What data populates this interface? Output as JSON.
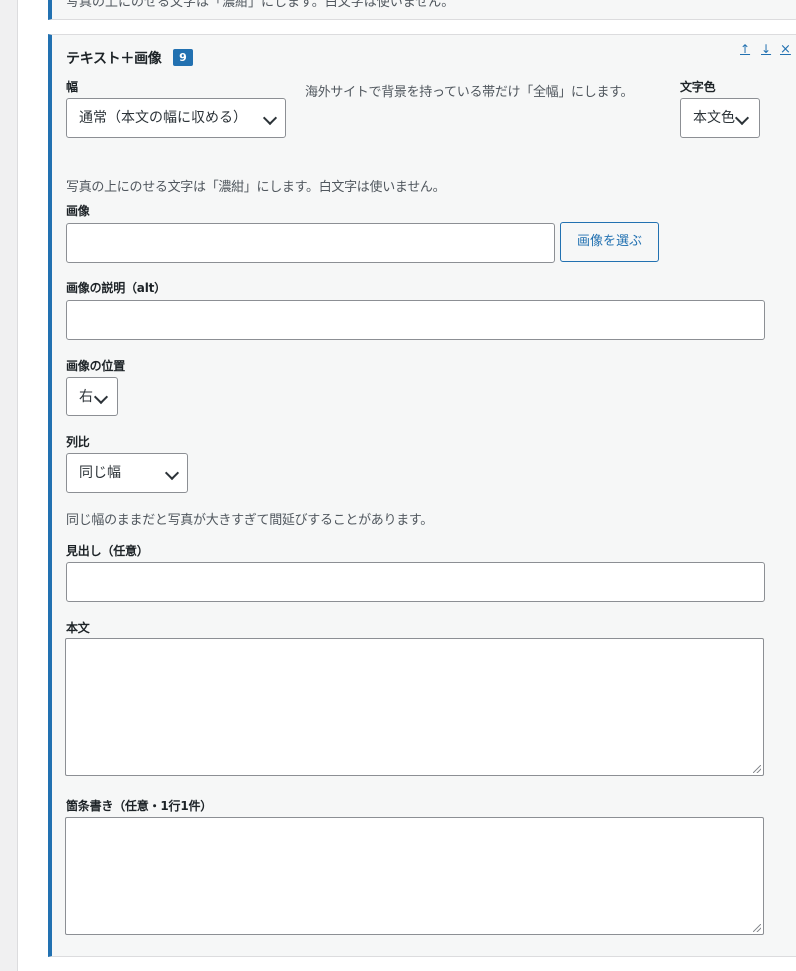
{
  "previous_block": {
    "help_cut": "写真の上にのせる文字は「濃紺」にします。白文字は使いません。"
  },
  "block": {
    "title": "テキスト＋画像",
    "number_badge": "9",
    "controls": {
      "move_up": "↑",
      "move_down": "↓",
      "remove": "×"
    },
    "width": {
      "label": "幅",
      "selected": "通常（本文の幅に収める）"
    },
    "width_help": "海外サイトで背景を持っている帯だけ「全幅」にします。",
    "text_color": {
      "label": "文字色",
      "selected": "本文色"
    },
    "text_color_help": "写真の上にのせる文字は「濃紺」にします。白文字は使いません。",
    "image": {
      "label": "画像",
      "value": "",
      "button": "画像を選ぶ"
    },
    "image_alt": {
      "label": "画像の説明（alt）",
      "value": ""
    },
    "image_position": {
      "label": "画像の位置",
      "selected": "右"
    },
    "column_ratio": {
      "label": "列比",
      "selected": "同じ幅",
      "help": "同じ幅のままだと写真が大きすぎて間延びすることがあります。"
    },
    "heading": {
      "label": "見出し（任意）",
      "value": ""
    },
    "body": {
      "label": "本文",
      "value": ""
    },
    "bullets": {
      "label": "箇条書き（任意・1行1件）",
      "value": ""
    }
  }
}
